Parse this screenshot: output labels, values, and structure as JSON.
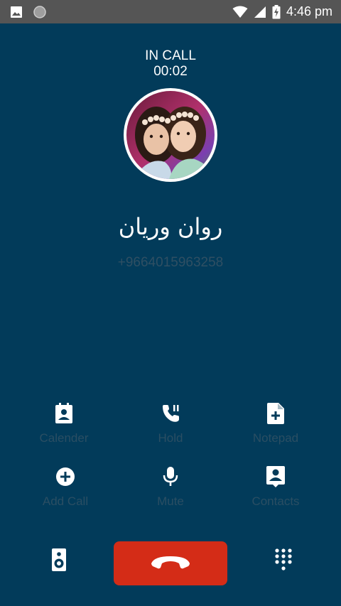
{
  "status_bar": {
    "time": "4:46 pm",
    "icons": [
      "image-icon",
      "circle-notification-icon",
      "wifi-icon",
      "cell-signal-icon",
      "battery-charging-icon"
    ]
  },
  "call": {
    "state": "IN CALL",
    "duration": "00:02",
    "caller_name": "روان وريان",
    "caller_number": "+9664015963258"
  },
  "actions": [
    {
      "label": "Calender",
      "icon": "calendar-contact-icon"
    },
    {
      "label": "Hold",
      "icon": "phone-pause-icon"
    },
    {
      "label": "Notepad",
      "icon": "note-add-icon"
    },
    {
      "label": "Add Call",
      "icon": "add-circle-icon"
    },
    {
      "label": "Mute",
      "icon": "microphone-icon"
    },
    {
      "label": "Contacts",
      "icon": "contact-card-icon"
    }
  ],
  "bottom": {
    "speaker_icon": "speaker-icon",
    "end_icon": "call-end-icon",
    "dialpad_icon": "dialpad-icon"
  },
  "colors": {
    "background": "#023B5A",
    "end_call": "#D42C17",
    "label": "#2A4E63"
  }
}
